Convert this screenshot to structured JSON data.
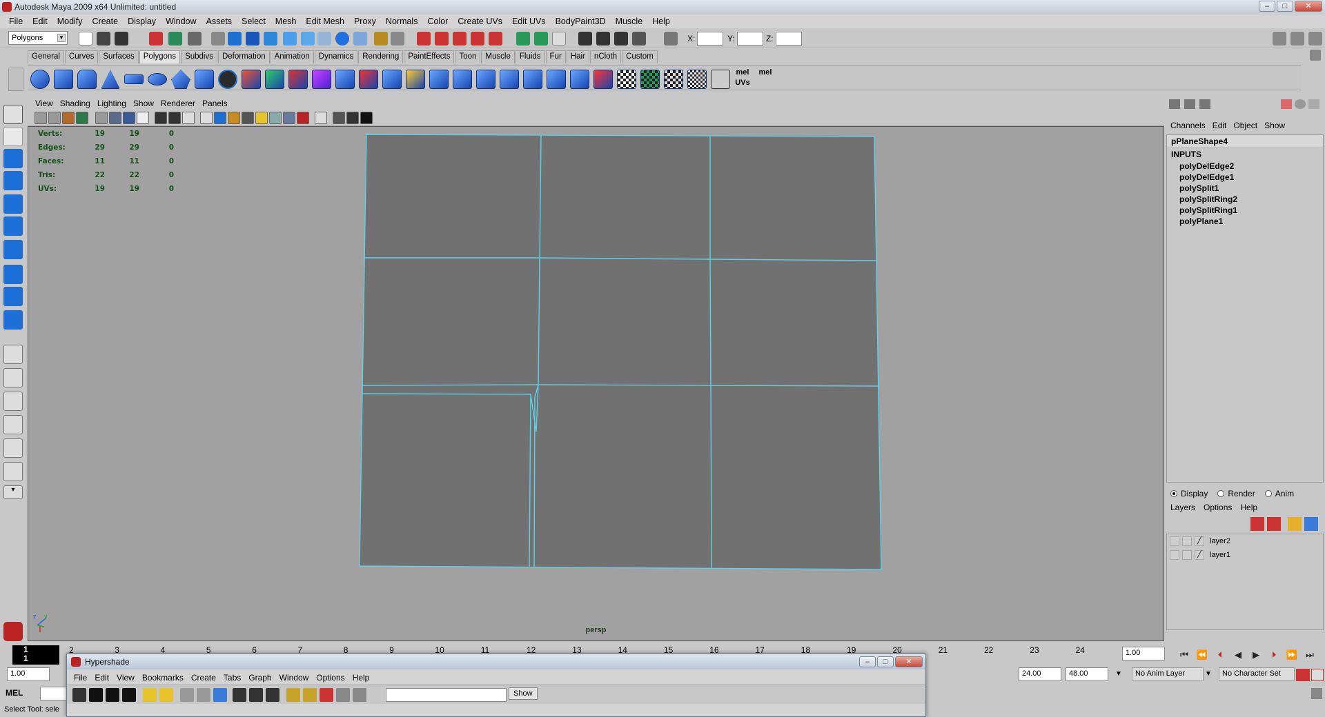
{
  "window": {
    "title": "Autodesk Maya 2009 x64 Unlimited: untitled"
  },
  "menubar": [
    "File",
    "Edit",
    "Modify",
    "Create",
    "Display",
    "Window",
    "Assets",
    "Select",
    "Mesh",
    "Edit Mesh",
    "Proxy",
    "Normals",
    "Color",
    "Create UVs",
    "Edit UVs",
    "BodyPaint3D",
    "Muscle",
    "Help"
  ],
  "statusline": {
    "menu_set": "Polygons",
    "x_label": "X:",
    "y_label": "Y:",
    "z_label": "Z:"
  },
  "shelf_tabs": [
    "General",
    "Curves",
    "Surfaces",
    "Polygons",
    "Subdivs",
    "Deformation",
    "Animation",
    "Dynamics",
    "Rendering",
    "PaintEffects",
    "Toon",
    "Muscle",
    "Fluids",
    "Fur",
    "Hair",
    "nCloth",
    "Custom"
  ],
  "shelf_active": "Polygons",
  "shelf_labels": {
    "mel1": "mel",
    "uvs": "UVs",
    "mel2": "mel"
  },
  "viewport": {
    "menu": [
      "View",
      "Shading",
      "Lighting",
      "Show",
      "Renderer",
      "Panels"
    ],
    "hud": [
      {
        "k": "Verts:",
        "a": "19",
        "b": "19",
        "c": "0"
      },
      {
        "k": "Edges:",
        "a": "29",
        "b": "29",
        "c": "0"
      },
      {
        "k": "Faces:",
        "a": "11",
        "b": "11",
        "c": "0"
      },
      {
        "k": "Tris:",
        "a": "22",
        "b": "22",
        "c": "0"
      },
      {
        "k": "UVs:",
        "a": "19",
        "b": "19",
        "c": "0"
      }
    ],
    "camera": "persp",
    "axis_z": "z",
    "axis_y": "y",
    "mesh_color": "#717171",
    "wire_color": "#5fd0e8",
    "bg_color": "#a1a1a1"
  },
  "channel_box": {
    "menu": [
      "Channels",
      "Edit",
      "Object",
      "Show"
    ],
    "object": "pPlaneShape4",
    "inputs_label": "INPUTS",
    "nodes": [
      "polyDelEdge2",
      "polyDelEdge1",
      "polySplit1",
      "polySplitRing2",
      "polySplitRing1",
      "polyPlane1"
    ]
  },
  "layer_editor": {
    "radios": [
      {
        "label": "Display",
        "on": true
      },
      {
        "label": "Render",
        "on": false
      },
      {
        "label": "Anim",
        "on": false
      }
    ],
    "menu": [
      "Layers",
      "Options",
      "Help"
    ],
    "layers": [
      "layer2",
      "layer1"
    ]
  },
  "timeslider": {
    "current_frame": "1",
    "ticks": [
      "2",
      "3",
      "4",
      "5",
      "6",
      "7",
      "8",
      "9",
      "10",
      "11",
      "12",
      "13",
      "14",
      "15",
      "16",
      "17",
      "18",
      "19",
      "20",
      "21",
      "22",
      "23",
      "24"
    ],
    "current_time": "1.00"
  },
  "range": {
    "start": "1.00",
    "end": "24.00",
    "max": "48.00",
    "anim_layer": "No Anim Layer",
    "char_set": "No Character Set"
  },
  "cmdline": {
    "label": "MEL"
  },
  "helpline": {
    "text": "Select Tool: sele"
  },
  "hypershade": {
    "title": "Hypershade",
    "menu": [
      "File",
      "Edit",
      "View",
      "Bookmarks",
      "Create",
      "Tabs",
      "Graph",
      "Window",
      "Options",
      "Help"
    ],
    "show_label": "Show"
  }
}
